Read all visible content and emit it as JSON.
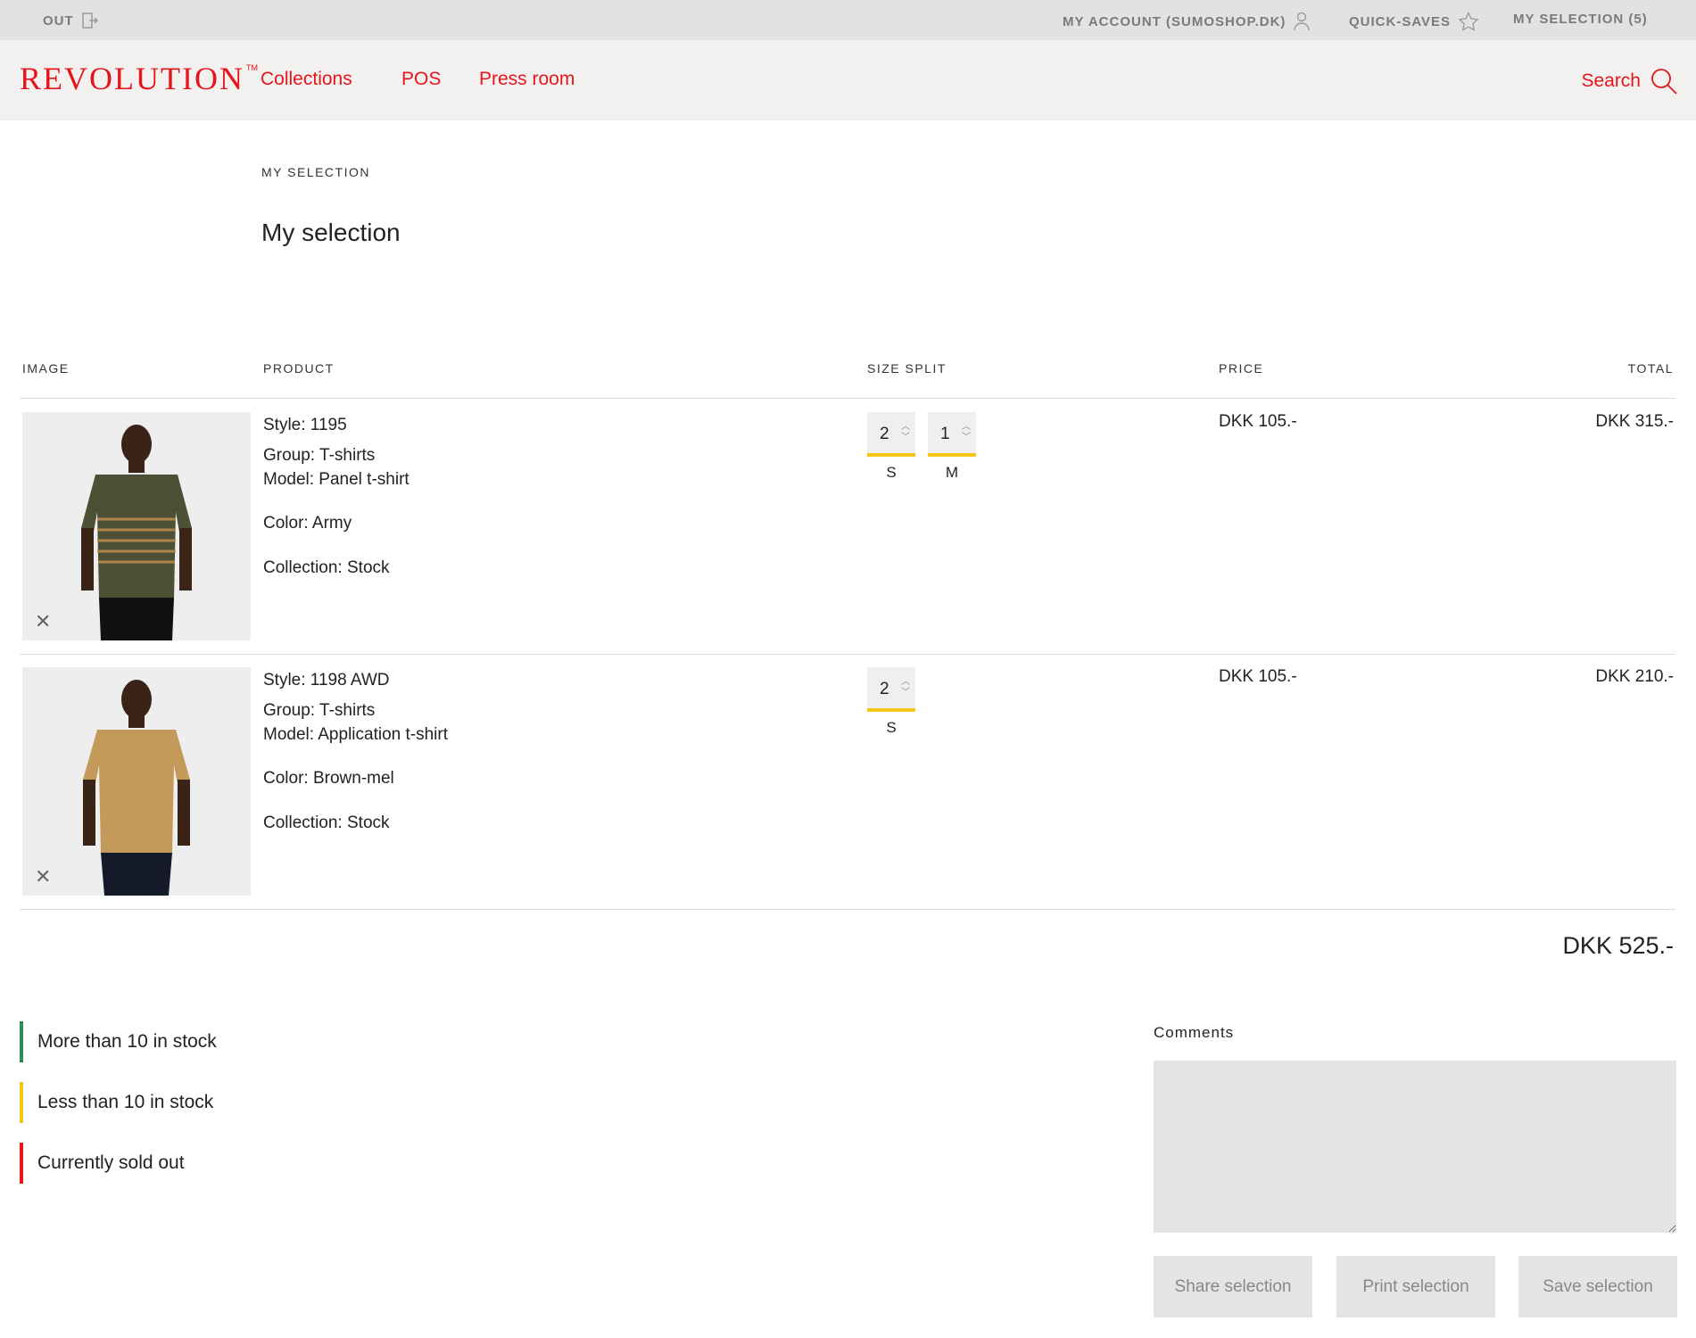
{
  "topbar": {
    "logout_label": "OUT",
    "account_label": "MY ACCOUNT (SUMOSHOP.DK)",
    "quicksaves_label": "QUICK-SAVES",
    "selection_label": "MY SELECTION (5)"
  },
  "nav": {
    "logo": "REVOLUTION",
    "logo_tm": "TM",
    "links": [
      "Collections",
      "POS",
      "Press room"
    ],
    "search_label": "Search"
  },
  "breadcrumb": "MY SELECTION",
  "page_title": "My selection",
  "table": {
    "headers": {
      "image": "IMAGE",
      "product": "PRODUCT",
      "size_split": "SIZE SPLIT",
      "price": "PRICE",
      "total": "TOTAL"
    },
    "rows": [
      {
        "style": "Style: 1195",
        "group": "Group: T-shirts",
        "model": "Model: Panel t-shirt",
        "color": "Color: Army",
        "collection": "Collection: Stock",
        "sizes": [
          {
            "qty": "2",
            "label": "S"
          },
          {
            "qty": "1",
            "label": "M"
          }
        ],
        "price": "DKK 105.-",
        "total": "DKK 315.-",
        "shirt_color": "#4d5035"
      },
      {
        "style": "Style: 1198 AWD",
        "group": "Group: T-shirts",
        "model": "Model: Application t-shirt",
        "color": "Color: Brown-mel",
        "collection": "Collection: Stock",
        "sizes": [
          {
            "qty": "2",
            "label": "S"
          }
        ],
        "price": "DKK 105.-",
        "total": "DKK 210.-",
        "shirt_color": "#c49a5a"
      }
    ]
  },
  "grand_total": "DKK 525.-",
  "legend": [
    {
      "label": "More than 10 in stock",
      "color": "#2e8b57"
    },
    {
      "label": "Less than 10 in stock",
      "color": "#f5c518"
    },
    {
      "label": "Currently sold out",
      "color": "#e8141c"
    }
  ],
  "comments": {
    "label": "Comments",
    "value": ""
  },
  "buttons": {
    "share": "Share selection",
    "print": "Print selection",
    "save": "Save selection"
  },
  "colors": {
    "accent": "#e8141c",
    "stock_indicator": "#f5c518"
  }
}
